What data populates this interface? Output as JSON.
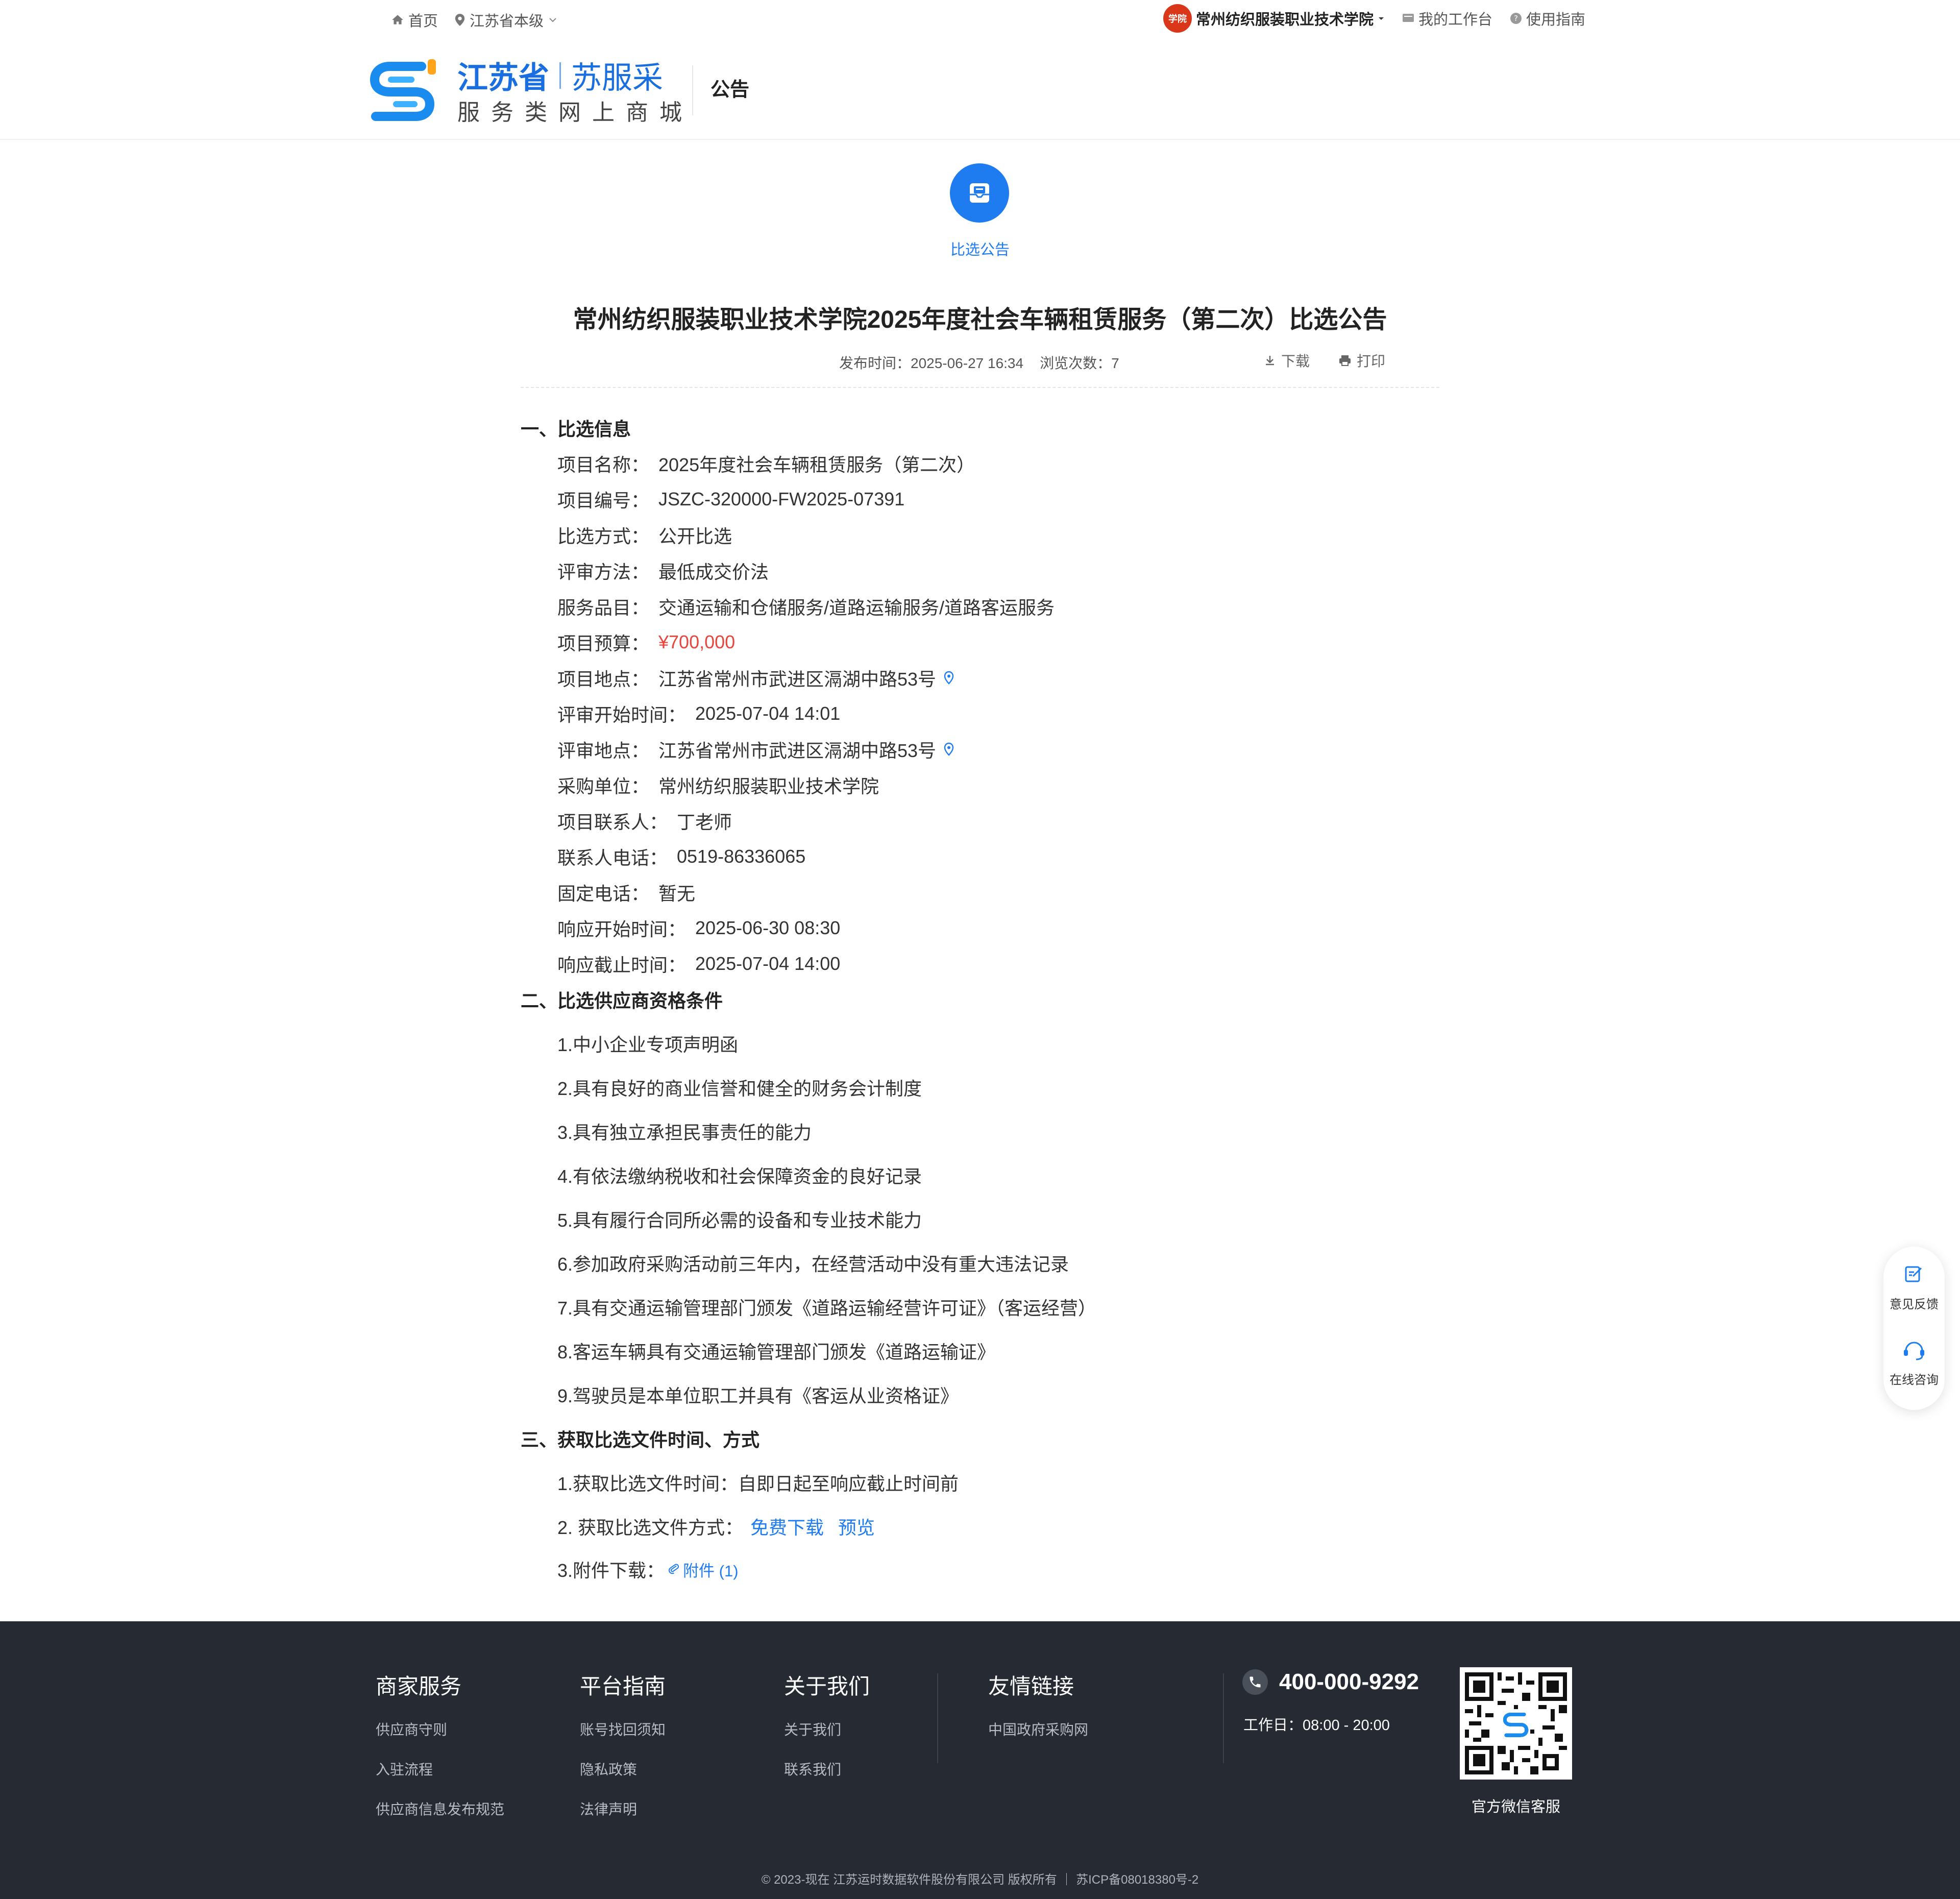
{
  "topbar": {
    "home": "首页",
    "region": "江苏省本级",
    "avatar_text": "学院",
    "org": "常州纺织服装职业技术学院",
    "workbench": "我的工作台",
    "guide": "使用指南"
  },
  "header": {
    "brand_main": "江苏省",
    "brand_sub": "苏服采",
    "brand_line2": "服务类网上商城",
    "page_kind": "公告"
  },
  "notice": {
    "icon": "mail-icon",
    "label": "比选公告",
    "title": "常州纺织服装职业技术学院2025年度社会车辆租赁服务（第二次）比选公告",
    "publish_time": "发布时间：2025-06-27 16:34",
    "views": "浏览次数：7",
    "download": "下载",
    "print": "打印"
  },
  "sections": {
    "s1": "一、比选信息",
    "s2": "二、比选供应商资格条件",
    "s3": "三、获取比选文件时间、方式"
  },
  "info": [
    {
      "k": "项目名称：",
      "v": "2025年度社会车辆租赁服务（第二次）"
    },
    {
      "k": "项目编号：",
      "v": "JSZC-320000-FW2025-07391"
    },
    {
      "k": "比选方式：",
      "v": "公开比选"
    },
    {
      "k": "评审方法：",
      "v": "最低成交价法"
    },
    {
      "k": "服务品目：",
      "v": "交通运输和仓储服务/道路运输服务/道路客运服务"
    },
    {
      "k": "项目预算：",
      "v": "¥700,000"
    },
    {
      "k": "项目地点：",
      "v": "江苏省常州市武进区滆湖中路53号"
    },
    {
      "k": "评审开始时间：",
      "v": "2025-07-04 14:01"
    },
    {
      "k": "评审地点：",
      "v": "江苏省常州市武进区滆湖中路53号"
    },
    {
      "k": "采购单位：",
      "v": "常州纺织服装职业技术学院"
    },
    {
      "k": "项目联系人：",
      "v": "丁老师"
    },
    {
      "k": "联系人电话：",
      "v": "0519-86336065"
    },
    {
      "k": "固定电话：",
      "v": "暂无"
    },
    {
      "k": "响应开始时间：",
      "v": "2025-06-30 08:30"
    },
    {
      "k": "响应截止时间：",
      "v": "2025-07-04 14:00"
    }
  ],
  "quals": [
    "1.中小企业专项声明函",
    "2.具有良好的商业信誉和健全的财务会计制度",
    "3.具有独立承担民事责任的能力",
    "4.有依法缴纳税收和社会保障资金的良好记录",
    "5.具有履行合同所必需的设备和专业技术能力",
    "6.参加政府采购活动前三年内，在经营活动中没有重大违法记录",
    "7.具有交通运输管理部门颁发《道路运输经营许可证》（客运经营）",
    "8.客运车辆具有交通运输管理部门颁发《道路运输证》",
    "9.驾驶员是本单位职工并具有《客运从业资格证》"
  ],
  "obtain": {
    "time": "1.获取比选文件时间：自即日起至响应截止时间前",
    "method_label": "2. 获取比选文件方式：",
    "free_download": "免费下载",
    "preview": "预览",
    "attach_label": "3.附件下载：",
    "attach_link": "附件 (1)"
  },
  "side": {
    "feedback": "意见反馈",
    "consult": "在线咨询"
  },
  "footer": {
    "col1": {
      "title": "商家服务",
      "links": [
        "供应商守则",
        "入驻流程",
        "供应商信息发布规范"
      ]
    },
    "col2": {
      "title": "平台指南",
      "links": [
        "账号找回须知",
        "隐私政策",
        "法律声明"
      ]
    },
    "col3": {
      "title": "关于我们",
      "links": [
        "关于我们",
        "联系我们"
      ]
    },
    "col4": {
      "title": "友情链接",
      "links": [
        "中国政府采购网"
      ]
    },
    "phone": "400-000-9292",
    "hours": "工作日：08:00 - 20:00",
    "qr_label": "官方微信客服",
    "copyright": "© 2023-现在 江苏运时数据软件股份有限公司 版权所有 ｜ 苏ICP备08018380号-2"
  },
  "colors": {
    "accent": "#1e7cf0",
    "price": "#e8453c",
    "footer_bg": "#262b33"
  }
}
